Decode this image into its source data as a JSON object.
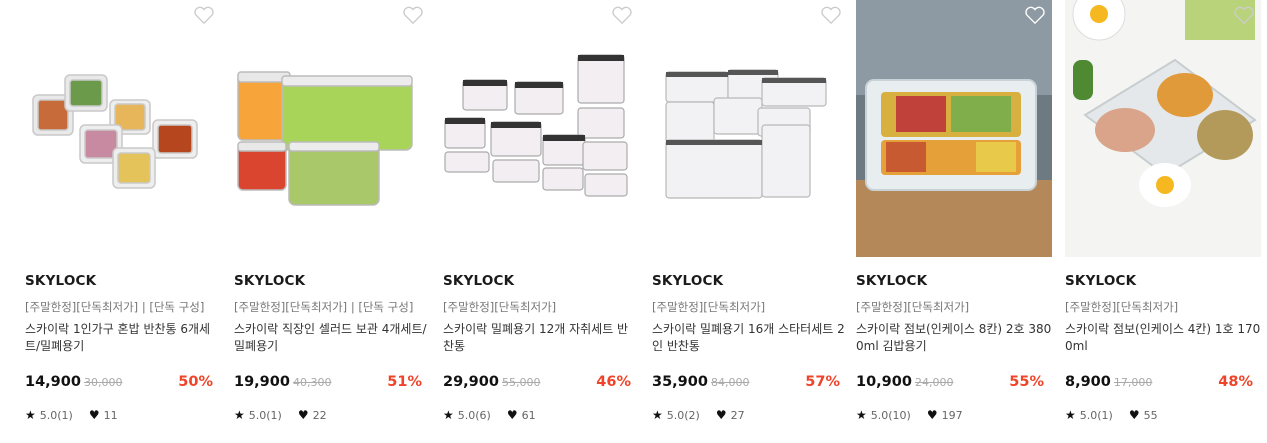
{
  "products": [
    {
      "brand": "SKYLOCK",
      "tags": "[주말한정][단독최저가] | [단독 구성]",
      "name": "스카이락 1인가구 혼밥 반찬통 6개세트/밀폐용기",
      "price": "14,900",
      "original_price": "30,000",
      "discount": "50%",
      "rating": "5.0(1)",
      "likes": "11",
      "image": "glass-containers-with-food",
      "wish_icon": "heart-outline-icon"
    },
    {
      "brand": "SKYLOCK",
      "tags": "[주말한정][단독최저가] | [단독 구성]",
      "name": "스카이락 직장인 셀러드 보관 4개세트/밀폐용기",
      "price": "19,900",
      "original_price": "40,300",
      "discount": "51%",
      "rating": "5.0(1)",
      "likes": "22",
      "image": "salad-containers",
      "wish_icon": "heart-outline-icon"
    },
    {
      "brand": "SKYLOCK",
      "tags": "[주말한정][단독최저가]",
      "name": "스카이락 밀폐용기 12개 자취세트 반찬통",
      "price": "29,900",
      "original_price": "55,000",
      "discount": "46%",
      "rating": "5.0(6)",
      "likes": "61",
      "image": "container-set-12",
      "wish_icon": "heart-outline-icon"
    },
    {
      "brand": "SKYLOCK",
      "tags": "[주말한정][단독최저가]",
      "name": "스카이락 밀폐용기 16개 스타터세트 2인 반찬통",
      "price": "35,900",
      "original_price": "84,000",
      "discount": "57%",
      "rating": "5.0(2)",
      "likes": "27",
      "image": "container-set-16",
      "wish_icon": "heart-outline-icon"
    },
    {
      "brand": "SKYLOCK",
      "tags": "[주말한정][단독최저가]",
      "name": "스카이락 점보(인케이스 8칸) 2호 3800ml 김밥용기",
      "price": "10,900",
      "original_price": "24,000",
      "discount": "55%",
      "rating": "5.0(10)",
      "likes": "197",
      "image": "jumbo-container-kimbap",
      "wish_icon": "heart-outline-icon"
    },
    {
      "brand": "SKYLOCK",
      "tags": "[주말한정][단독최저가]",
      "name": "스카이락 점보(인케이스 4칸) 1호 1700ml",
      "price": "8,900",
      "original_price": "17,000",
      "discount": "48%",
      "rating": "5.0(1)",
      "likes": "55",
      "image": "jumbo-container-egg-chicken",
      "wish_icon": "heart-outline-icon"
    }
  ],
  "colors": {
    "discount": "#f0442a",
    "text": "#222222",
    "muted": "#777777"
  },
  "icons": {
    "rating": "star-icon",
    "likes": "heart-filled-icon"
  }
}
